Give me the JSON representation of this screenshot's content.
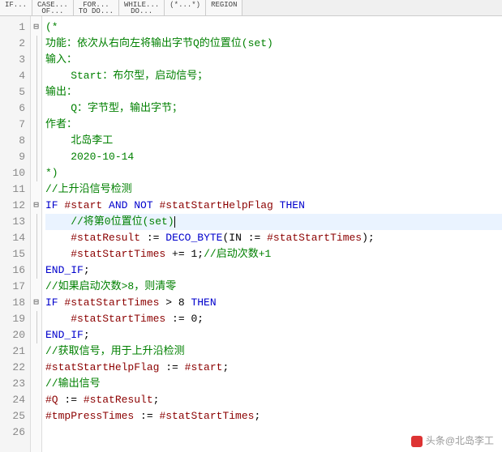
{
  "tabs": [
    {
      "l1": "IF...",
      "l2": ""
    },
    {
      "l1": "CASE...",
      "l2": "OF..."
    },
    {
      "l1": "FOR...",
      "l2": "TO DO..."
    },
    {
      "l1": "WHILE...",
      "l2": "DO..."
    },
    {
      "l1": "(*...*)",
      "l2": ""
    },
    {
      "l1": "REGION",
      "l2": ""
    }
  ],
  "lines": [
    {
      "n": 1,
      "fold": "box",
      "seg": [
        {
          "c": "cmt",
          "t": "(*"
        }
      ]
    },
    {
      "n": 2,
      "fold": "line",
      "seg": [
        {
          "c": "cmt",
          "t": "功能：依次从右向左将输出字节Q的位置位(set)"
        }
      ]
    },
    {
      "n": 3,
      "fold": "line",
      "seg": [
        {
          "c": "cmt",
          "t": "输入："
        }
      ]
    },
    {
      "n": 4,
      "fold": "line",
      "seg": [
        {
          "c": "cmt",
          "t": "    Start：布尔型，启动信号；"
        }
      ]
    },
    {
      "n": 5,
      "fold": "line",
      "seg": [
        {
          "c": "cmt",
          "t": "输出："
        }
      ]
    },
    {
      "n": 6,
      "fold": "line",
      "seg": [
        {
          "c": "cmt",
          "t": "    Q：字节型，输出字节；"
        }
      ]
    },
    {
      "n": 7,
      "fold": "line",
      "seg": [
        {
          "c": "cmt",
          "t": "作者："
        }
      ]
    },
    {
      "n": 8,
      "fold": "line",
      "seg": [
        {
          "c": "cmt",
          "t": "    北岛李工"
        }
      ]
    },
    {
      "n": 9,
      "fold": "line",
      "seg": [
        {
          "c": "cmt",
          "t": "    2020-10-14"
        }
      ]
    },
    {
      "n": 10,
      "fold": "line",
      "seg": [
        {
          "c": "cmt",
          "t": "*)"
        }
      ]
    },
    {
      "n": 11,
      "fold": "",
      "seg": [
        {
          "c": "cmt",
          "t": "//上升沿信号检测"
        }
      ]
    },
    {
      "n": 12,
      "fold": "box",
      "seg": [
        {
          "c": "kw",
          "t": "IF "
        },
        {
          "c": "var",
          "t": "#start"
        },
        {
          "c": "kw",
          "t": " AND NOT "
        },
        {
          "c": "var",
          "t": "#statStartHelpFlag"
        },
        {
          "c": "kw",
          "t": " THEN"
        }
      ]
    },
    {
      "n": 13,
      "fold": "line",
      "hl": true,
      "seg": [
        {
          "c": "cmt",
          "t": "    //将第0位置位(set)"
        }
      ],
      "cursor": true
    },
    {
      "n": 14,
      "fold": "line",
      "seg": [
        {
          "c": "pun",
          "t": "    "
        },
        {
          "c": "var",
          "t": "#statResult"
        },
        {
          "c": "pun",
          "t": " := "
        },
        {
          "c": "kw",
          "t": "DECO_BYTE"
        },
        {
          "c": "pun",
          "t": "(IN := "
        },
        {
          "c": "var",
          "t": "#statStartTimes"
        },
        {
          "c": "pun",
          "t": ");"
        }
      ]
    },
    {
      "n": 15,
      "fold": "line",
      "seg": [
        {
          "c": "pun",
          "t": "    "
        },
        {
          "c": "var",
          "t": "#statStartTimes"
        },
        {
          "c": "pun",
          "t": " += "
        },
        {
          "c": "num",
          "t": "1"
        },
        {
          "c": "pun",
          "t": ";"
        },
        {
          "c": "cmt",
          "t": "//启动次数+1"
        }
      ]
    },
    {
      "n": 16,
      "fold": "line",
      "seg": [
        {
          "c": "kw",
          "t": "END_IF"
        },
        {
          "c": "pun",
          "t": ";"
        }
      ]
    },
    {
      "n": 17,
      "fold": "",
      "seg": [
        {
          "c": "cmt",
          "t": "//如果启动次数>8，则清零"
        }
      ]
    },
    {
      "n": 18,
      "fold": "box",
      "seg": [
        {
          "c": "kw",
          "t": "IF "
        },
        {
          "c": "var",
          "t": "#statStartTimes"
        },
        {
          "c": "pun",
          "t": " > "
        },
        {
          "c": "num",
          "t": "8"
        },
        {
          "c": "kw",
          "t": " THEN"
        }
      ]
    },
    {
      "n": 19,
      "fold": "line",
      "seg": [
        {
          "c": "pun",
          "t": "    "
        },
        {
          "c": "var",
          "t": "#statStartTimes"
        },
        {
          "c": "pun",
          "t": " := "
        },
        {
          "c": "num",
          "t": "0"
        },
        {
          "c": "pun",
          "t": ";"
        }
      ]
    },
    {
      "n": 20,
      "fold": "line",
      "seg": [
        {
          "c": "kw",
          "t": "END_IF"
        },
        {
          "c": "pun",
          "t": ";"
        }
      ]
    },
    {
      "n": 21,
      "fold": "",
      "seg": [
        {
          "c": "cmt",
          "t": "//获取信号，用于上升沿检测"
        }
      ]
    },
    {
      "n": 22,
      "fold": "",
      "seg": [
        {
          "c": "var",
          "t": "#statStartHelpFlag"
        },
        {
          "c": "pun",
          "t": " := "
        },
        {
          "c": "var",
          "t": "#start"
        },
        {
          "c": "pun",
          "t": ";"
        }
      ]
    },
    {
      "n": 23,
      "fold": "",
      "seg": [
        {
          "c": "cmt",
          "t": "//输出信号"
        }
      ]
    },
    {
      "n": 24,
      "fold": "",
      "seg": [
        {
          "c": "var",
          "t": "#Q"
        },
        {
          "c": "pun",
          "t": " := "
        },
        {
          "c": "var",
          "t": "#statResult"
        },
        {
          "c": "pun",
          "t": ";"
        }
      ]
    },
    {
      "n": 25,
      "fold": "",
      "seg": [
        {
          "c": "var",
          "t": "#tmpPressTimes"
        },
        {
          "c": "pun",
          "t": " := "
        },
        {
          "c": "var",
          "t": "#statStartTimes"
        },
        {
          "c": "pun",
          "t": ";"
        }
      ]
    },
    {
      "n": 26,
      "fold": "",
      "seg": []
    }
  ],
  "watermark": "头条@北岛李工"
}
